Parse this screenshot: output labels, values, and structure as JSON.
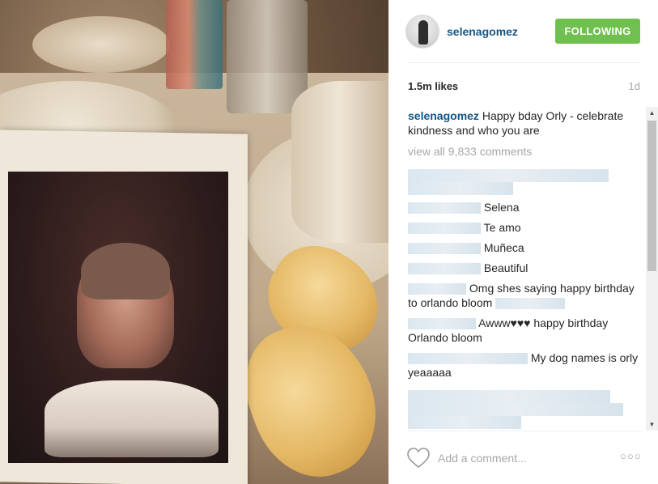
{
  "post": {
    "username": "selenagomez",
    "follow_label": "FOLLOWING",
    "likes": "1.5m likes",
    "time_ago": "1d",
    "caption_user": "selenagomez",
    "caption_text": "Happy bday Orly - celebrate kindness and who you are",
    "view_all": "view all 9,833 comments"
  },
  "comments": [
    {
      "text": "Selena"
    },
    {
      "text": "Te amo"
    },
    {
      "text": "Muñeca"
    },
    {
      "text": "Beautiful"
    },
    {
      "text": "Omg shes saying happy birthday to orlando bloom"
    },
    {
      "text": "Awww♥♥♥ happy birthday Orlando bloom"
    },
    {
      "text": "My dog names is orly yeaaaaa"
    }
  ],
  "footer": {
    "add_comment_placeholder": "Add a comment...",
    "more_label": "○○○"
  },
  "colors": {
    "follow_button": "#70c050",
    "username_link": "#125688",
    "muted_text": "#a5a7aa"
  },
  "icons": {
    "like": "heart-outline-icon",
    "more": "ellipsis-icon"
  }
}
